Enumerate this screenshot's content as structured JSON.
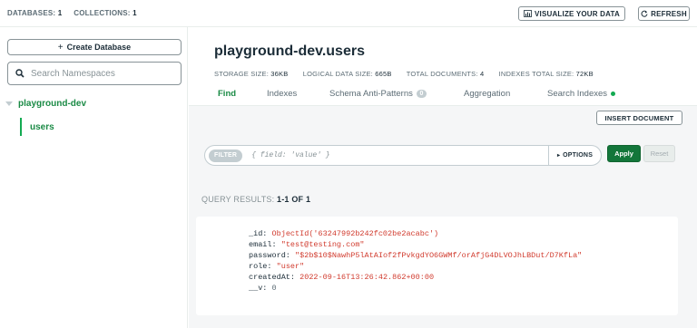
{
  "topbar": {
    "databases_label": "DATABASES:",
    "databases_count": "1",
    "collections_label": "COLLECTIONS:",
    "collections_count": "1",
    "visualize_label": "VISUALIZE YOUR DATA",
    "refresh_label": "REFRESH"
  },
  "sidebar": {
    "create_db_label": "Create Database",
    "search_placeholder": "Search Namespaces",
    "database_name": "playground-dev",
    "collection_name": "users"
  },
  "collection": {
    "title": "playground-dev.users",
    "stats": [
      {
        "label": "STORAGE SIZE:",
        "value": "36KB"
      },
      {
        "label": "LOGICAL DATA SIZE:",
        "value": "665B"
      },
      {
        "label": "TOTAL DOCUMENTS:",
        "value": "4"
      },
      {
        "label": "INDEXES TOTAL SIZE:",
        "value": "72KB"
      }
    ]
  },
  "tabs": [
    {
      "label": "Find"
    },
    {
      "label": "Indexes"
    },
    {
      "label": "Schema Anti-Patterns",
      "badge": "0"
    },
    {
      "label": "Aggregation"
    },
    {
      "label": "Search Indexes"
    }
  ],
  "toolbar": {
    "insert_label": "INSERT DOCUMENT",
    "filter_tag": "FILTER",
    "filter_placeholder": "{ field: 'value' }",
    "options_label": "OPTIONS",
    "apply_label": "Apply",
    "reset_label": "Reset"
  },
  "results": {
    "label": "QUERY RESULTS:",
    "range": "1-1 OF 1"
  },
  "document": [
    {
      "key": "_id:",
      "value": "ObjectId('63247992b242fc02be2acabc')"
    },
    {
      "key": "email:",
      "value": "\"test@testing.com\""
    },
    {
      "key": "password:",
      "value": "\"$2b$10$NawhP5lAtAIof2fPvkgdYO6GWMf/orAfjG4DLVOJhLBDut/D7KfLa\""
    },
    {
      "key": "role:",
      "value": "\"user\""
    },
    {
      "key": "createdAt:",
      "value": "2022-09-16T13:26:42.862+00:00"
    },
    {
      "key": "__v:",
      "value": "0"
    }
  ],
  "colors": {
    "accent_green": "#13aa52",
    "apply_green": "#13763a",
    "value_red": "#d13b2e"
  }
}
